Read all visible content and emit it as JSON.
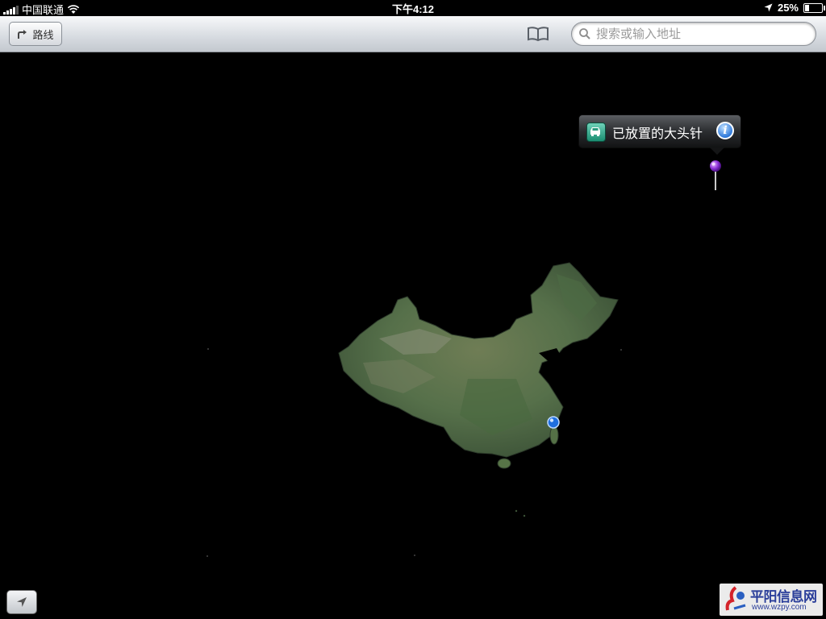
{
  "status_bar": {
    "carrier": "中国联通",
    "time": "下午4:12",
    "battery": "25%",
    "battery_level": 0.25
  },
  "toolbar": {
    "route_label": "路线",
    "search_placeholder": "搜索或输入地址",
    "bookmarks_icon": "book-icon"
  },
  "map": {
    "callout_label": "已放置的大头针",
    "callout_car_icon": "car-icon",
    "callout_info_icon": "info-icon",
    "info_glyph": "i",
    "pin_color": "#8b2fd6",
    "current_location_color": "#1f6fe0"
  },
  "watermark": {
    "text": "平阳信息网",
    "url": "www.wzpy.com"
  }
}
